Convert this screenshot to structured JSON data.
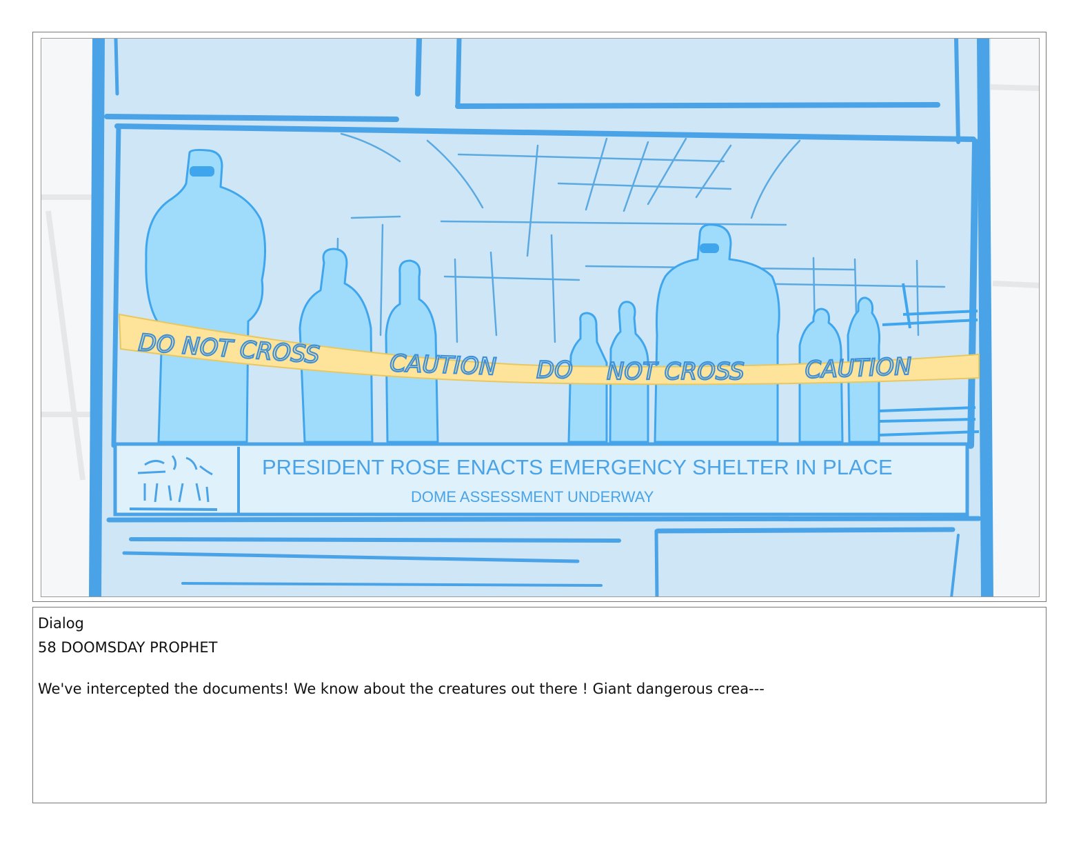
{
  "panel": {
    "chyron_headline": "PRESIDENT ROSE ENACTS EMERGENCY SHELTER IN PLACE",
    "chyron_subline": "DOME ASSESSMENT UNDERWAY",
    "tape_text_1": "DO NOT CROSS",
    "tape_text_2": "CAUTION",
    "tape_text_3": "DO",
    "tape_text_4": "NOT CROSS",
    "tape_text_5": "CAUTION",
    "colors": {
      "sky_fill": "#cfe6f7",
      "line_blue": "#4aa3e6",
      "figure_fill": "#9fdcfb",
      "tape_yellow": "#fde49a"
    }
  },
  "dialog": {
    "heading": "Dialog",
    "shot": "58 DOOMSDAY PROPHET",
    "text": "We've intercepted the documents! We know about the creatures out there ! Giant dangerous crea---"
  }
}
